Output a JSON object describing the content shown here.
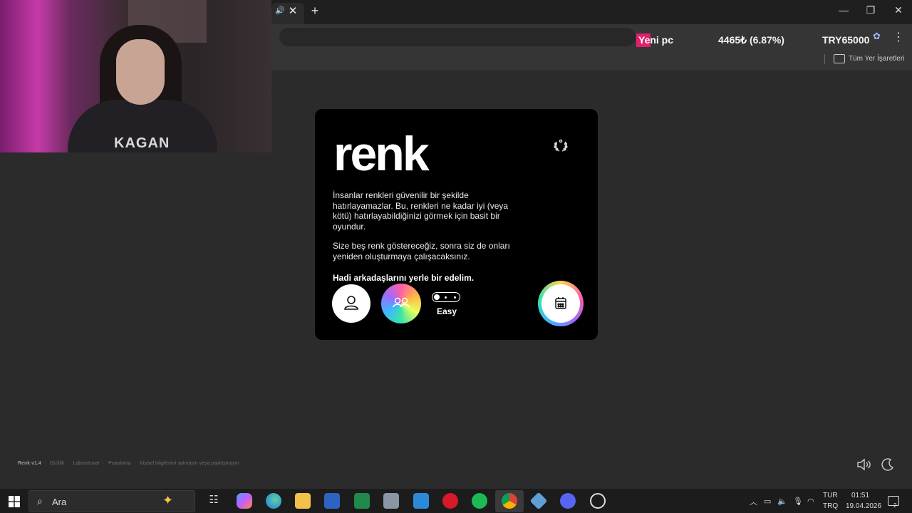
{
  "stream_overlay": {
    "goal_label": "Yeni pc",
    "progress_value": "4465₺ (6.87%)",
    "goal_target": "TRY65000",
    "progress_fraction": 0.0687
  },
  "bookmarks": {
    "all_bookmarks_label": "Tüm Yer İşaretleri"
  },
  "webcam": {
    "hoodie_print": "KAGAN"
  },
  "game": {
    "logo": "renk",
    "description_1": "İnsanlar renkleri güvenilir bir şekilde hatırlayamazlar. Bu, renkleri ne kadar iyi (veya kötü) hatırlayabildiğinizi görmek için basit bir oyundur.",
    "description_2": "Size beş renk göstereceğiz, sonra siz de onları yeniden oluşturmaya çalışacaksınız.",
    "cta": "Hadi arkadaşlarını yerle bir edelim.",
    "difficulty_label": "Easy",
    "icons": {
      "leaderboard": "laurel-icon",
      "solo": "person-icon",
      "multiplayer": "group-icon",
      "daily": "calendar-icon"
    }
  },
  "footer": {
    "brand": "Renk v1.4",
    "links": [
      "Gizlilik",
      "Laboratuvar",
      "Puanlama",
      "Kişisel bilgilerimi satmayın veya paylaşmayın"
    ]
  },
  "taskbar": {
    "search_placeholder": "Ara",
    "lang_1": "TUR",
    "lang_2": "TRQ",
    "time": "01:51",
    "date": "19.04.2026",
    "notification_count": "2"
  },
  "colors": {
    "accent_pink": "#e0206a",
    "card_bg": "#000000",
    "page_bg": "#2b2b2b"
  }
}
